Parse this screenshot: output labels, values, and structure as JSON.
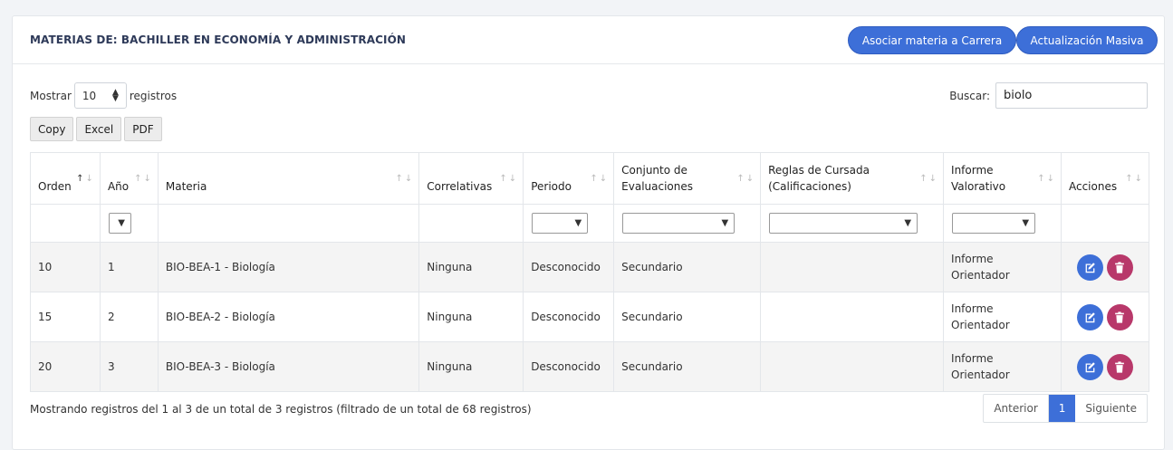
{
  "header": {
    "title": "MATERIAS DE: BACHILLER EN ECONOMÍA Y ADMINISTRACIÓN",
    "btn_associate": "Asociar materia a Carrera",
    "btn_bulk": "Actualización Masiva"
  },
  "length": {
    "prefix": "Mostrar",
    "value": "10",
    "suffix": "registros"
  },
  "search": {
    "label": "Buscar:",
    "value": "biolo"
  },
  "export_buttons": {
    "copy": "Copy",
    "excel": "Excel",
    "pdf": "PDF"
  },
  "table": {
    "columns": [
      "Orden",
      "Año",
      "Materia",
      "Correlativas",
      "Periodo",
      "Conjunto de Evaluaciones",
      "Reglas de Cursada (Calificaciones)",
      "Informe Valorativo",
      "Acciones"
    ],
    "rows": [
      {
        "orden": "10",
        "anio": "1",
        "materia": "BIO-BEA-1 - Biología",
        "correlativas": "Ninguna",
        "periodo": "Desconocido",
        "conjunto": "Secundario",
        "reglas": "",
        "informe": "Informe Orientador"
      },
      {
        "orden": "15",
        "anio": "2",
        "materia": "BIO-BEA-2 - Biología",
        "correlativas": "Ninguna",
        "periodo": "Desconocido",
        "conjunto": "Secundario",
        "reglas": "",
        "informe": "Informe Orientador"
      },
      {
        "orden": "20",
        "anio": "3",
        "materia": "BIO-BEA-3 - Biología",
        "correlativas": "Ninguna",
        "periodo": "Desconocido",
        "conjunto": "Secundario",
        "reglas": "",
        "informe": "Informe Orientador"
      }
    ]
  },
  "footer": {
    "info": "Mostrando registros del 1 al 3 de un total de 3 registros (filtrado de un total de 68 registros)",
    "prev": "Anterior",
    "page": "1",
    "next": "Siguiente"
  },
  "icons": {
    "edit": "edit-icon",
    "delete": "trash-icon",
    "sort": "sort-arrows-icon"
  },
  "colors": {
    "primary": "#3d6fd8",
    "danger": "#b8386a"
  }
}
